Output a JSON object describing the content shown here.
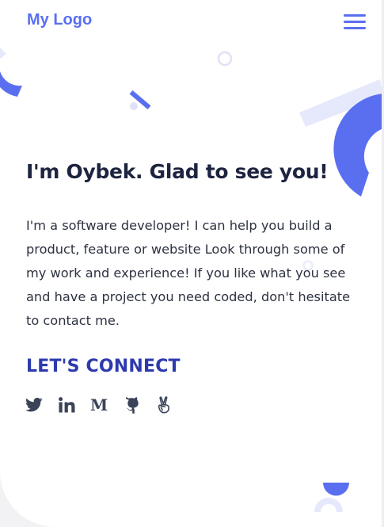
{
  "header": {
    "logo": "My Logo",
    "menu_icon": "hamburger-menu-icon"
  },
  "hero": {
    "headline": "I'm Oybek. Glad to see you!",
    "intro": "I'm a software developer! I can help you build a product, feature or website Look through some of my work and experience! If you like what you see and have a project you need coded, don't hesitate to contact me."
  },
  "connect": {
    "heading": "LET'S CONNECT",
    "links": [
      {
        "name": "twitter",
        "icon": "twitter-icon"
      },
      {
        "name": "linkedin",
        "icon": "linkedin-icon"
      },
      {
        "name": "medium",
        "icon": "medium-icon",
        "glyph": "M"
      },
      {
        "name": "github",
        "icon": "github-icon"
      },
      {
        "name": "angellist",
        "icon": "angellist-icon"
      }
    ]
  },
  "colors": {
    "accent": "#5a6ff0",
    "accent_light": "#e6e8fc",
    "heading": "#1d2440",
    "body": "#2d3240",
    "connect": "#2d3aad",
    "icons": "#3b4358"
  }
}
